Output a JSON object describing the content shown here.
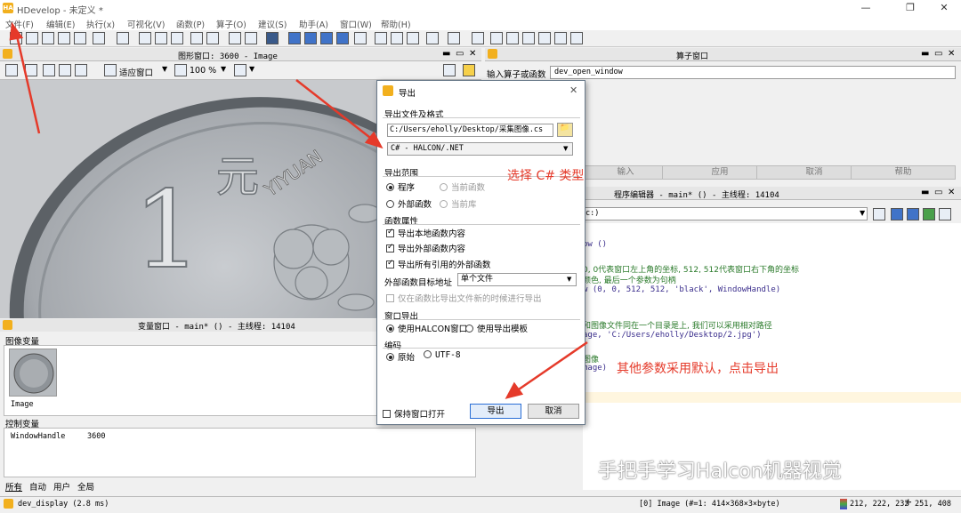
{
  "window": {
    "title": "HDevelop - 未定义 *",
    "logo": "HA",
    "controls": [
      "—",
      "❐",
      "✕"
    ]
  },
  "menu": [
    "文件(F)",
    "编辑(E)",
    "执行(x)",
    "可视化(V)",
    "函数(P)",
    "算子(O)",
    "建议(S)",
    "助手(A)",
    "窗口(W)",
    "帮助(H)"
  ],
  "graphics_window": {
    "caption": "图形窗口: 3600 - Image",
    "fit_label": "适应窗口",
    "zoom": "100 %"
  },
  "operator_window": {
    "caption": "算子窗口",
    "input_label": "输入算子或函数",
    "input_value": "dev_open_window",
    "buttons": [
      "输入",
      "应用",
      "取消",
      "帮助"
    ]
  },
  "program_editor": {
    "caption": "程序编辑器 - main* () - 主线程: 14104",
    "combo": "c:)",
    "lines": [
      {
        "text": "ow ()",
        "color": "purple"
      },
      {
        "text": "0, 0代表窗口左上角的坐标, 512, 512代表窗口右下角的坐标",
        "color": "green"
      },
      {
        "text": "颜色, 最后一个参数为句柄",
        "color": "green"
      },
      {
        "text": "w (0, 0, 512, 512, 'black', WindowHandle)",
        "color": "purple"
      },
      {
        "text": "和图像文件同在一个目录是上, 我们可以采用相对路径",
        "color": "green"
      },
      {
        "text": "age, 'C:/Users/eholly/Desktop/2.jpg')",
        "color": "purple"
      },
      {
        "text": "图像",
        "color": "green"
      },
      {
        "text": "mage)",
        "color": "purple"
      }
    ]
  },
  "variable_window": {
    "caption": "变量窗口 - main* () - 主线程: 14104",
    "image_vars_label": "图像变量",
    "image_var_name": "Image",
    "control_vars_label": "控制变量",
    "control_vars": [
      {
        "name": "WindowHandle",
        "value": "3600"
      }
    ],
    "tabs": [
      "所有",
      "自动",
      "用户",
      "全局"
    ]
  },
  "export_dialog": {
    "title": "导出",
    "file_format_label": "导出文件及格式",
    "file_path": "C:/Users/eholly/Desktop/采集图像.cs",
    "format": "C# - HALCON/.NET",
    "range_label": "导出范围",
    "range_options": [
      {
        "label": "程序",
        "selected": true,
        "enabled": true
      },
      {
        "label": "当前函数",
        "selected": false,
        "enabled": false
      },
      {
        "label": "外部函数",
        "selected": false,
        "enabled": true
      },
      {
        "label": "当前库",
        "selected": false,
        "enabled": false
      }
    ],
    "func_props_label": "函数属性",
    "checkboxes": [
      {
        "label": "导出本地函数内容",
        "checked": true,
        "enabled": true
      },
      {
        "label": "导出外部函数内容",
        "checked": true,
        "enabled": true
      },
      {
        "label": "导出所有引用的外部函数",
        "checked": true,
        "enabled": true
      }
    ],
    "ext_target_label": "外部函数目标地址",
    "ext_target_value": "单个文件",
    "only_newer_label": "仅在函数比导出文件新的时候进行导出",
    "window_export_label": "窗口导出",
    "window_options": [
      {
        "label": "使用HALCON窗口",
        "selected": true
      },
      {
        "label": "使用导出模板",
        "selected": false
      }
    ],
    "encoding_label": "编码",
    "encoding_options": [
      {
        "label": "原始",
        "selected": true
      },
      {
        "label": "UTF-8",
        "selected": false
      }
    ],
    "keep_open_label": "保持窗口打开",
    "export_button": "导出",
    "cancel_button": "取消"
  },
  "annotations": {
    "select_csharp": "选择 C# 类型",
    "click_export": "其他参数采用默认，点击导出",
    "color": "#e53a2a"
  },
  "status_bar": {
    "left": "dev_display (2.8 ms)",
    "image_info": "[0] Image (#=1: 414×368×3×byte)",
    "pixel_value": "212, 222, 232",
    "position": "251, 408"
  },
  "watermark": "手把手学习Halcon机器视觉",
  "coin": {
    "denomination": "1",
    "character": "元",
    "inscription": "YIYUAN"
  }
}
